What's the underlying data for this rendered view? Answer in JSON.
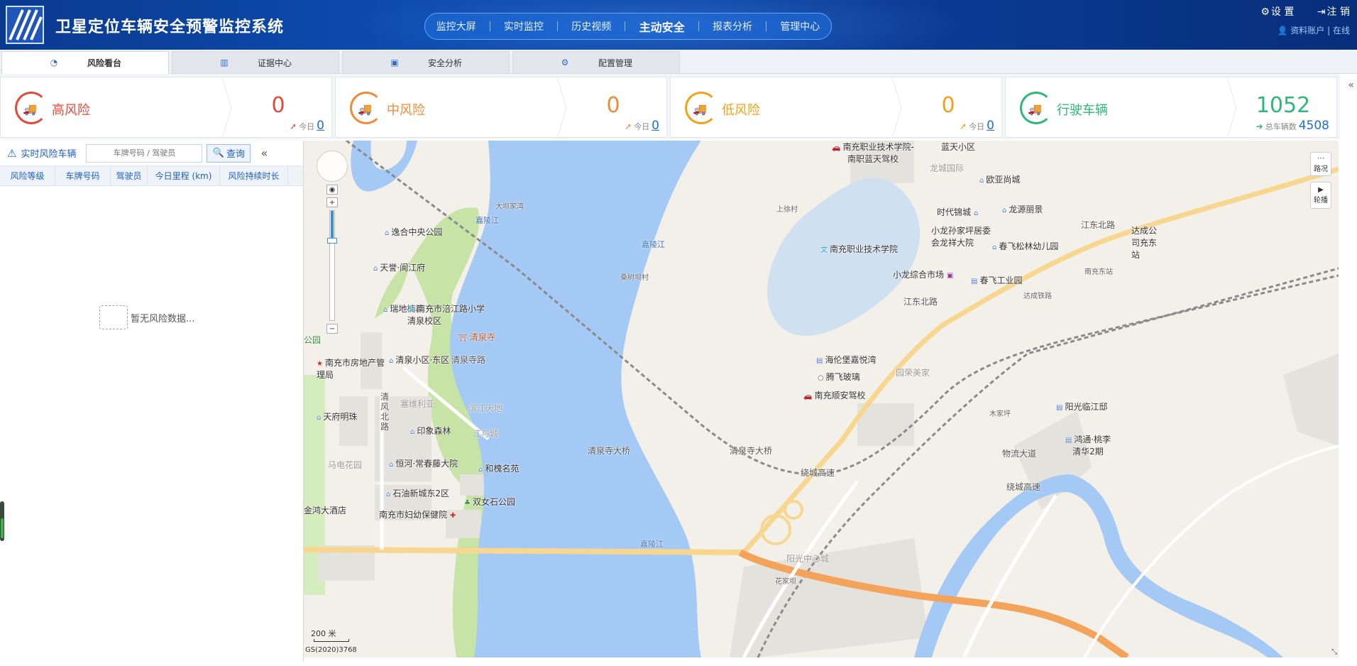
{
  "header": {
    "title": "卫星定位车辆安全预警监控系统",
    "nav": [
      "监控大屏",
      "实时监控",
      "历史视频",
      "主动安全",
      "报表分析",
      "管理中心"
    ],
    "active_nav": "主动安全",
    "settings_label": "设 置",
    "logout_label": "注 销",
    "account_label": "资料账户",
    "status_label": "在线"
  },
  "subtabs": {
    "items": [
      {
        "label": "风险看台",
        "icon": "clock-icon"
      },
      {
        "label": "证据中心",
        "icon": "bar-chart-icon"
      },
      {
        "label": "安全分析",
        "icon": "image-icon"
      },
      {
        "label": "配置管理",
        "icon": "gears-icon"
      }
    ]
  },
  "cards": [
    {
      "name": "高风险",
      "value": "0",
      "sub_label": "今日",
      "sub_value": "0",
      "color": "#e24a3b"
    },
    {
      "name": "中风险",
      "value": "0",
      "sub_label": "今日",
      "sub_value": "0",
      "color": "#f08b3a"
    },
    {
      "name": "低风险",
      "value": "0",
      "sub_label": "今日",
      "sub_value": "0",
      "color": "#f0a21a"
    },
    {
      "name": "行驶车辆",
      "value": "1052",
      "sub_label": "总车辆数",
      "sub_value": "4508",
      "color": "#2fb679"
    }
  ],
  "left_panel": {
    "title": "实时风险车辆",
    "search_placeholder": "车牌号码 / 驾驶员",
    "search_button": "查询",
    "columns": [
      "风险等级",
      "车牌号码",
      "驾驶员",
      "今日里程 (km)",
      "风险持续时长"
    ],
    "empty_text": "暂无风险数据..."
  },
  "map": {
    "controls": {
      "traffic_label": "路况",
      "playback_label": "轮播"
    },
    "scale_label": "200 米",
    "copyright": "GS(2020)3768",
    "labels": {
      "p01": "清泉寺大桥",
      "p02": "清泉寺大桥",
      "p03": "绕城高速",
      "p04": "绕城高速",
      "p05": "江东北路",
      "p06": "江东北路",
      "p07": "嘉陵江",
      "p08": "嘉陵江",
      "p09": "嘉陵江",
      "p10": "逸合中央公园",
      "p11": "天誉·阆江府",
      "p12": "瑞地楠郡",
      "p13": "南充市涪江路小学清泉校区",
      "p14": "清泉寺",
      "p15": "南充市房地产管理局",
      "p16": "清泉小区·东区",
      "p17": "天府明珠",
      "p18": "印象森林",
      "p19": "恒河·常春藤大院",
      "p20": "和槐名苑",
      "p21": "石油新城东2区",
      "p22": "双女石公园",
      "p23": "南充市妇幼保健院",
      "p24": "金鸿大酒店",
      "p25": "马电花园",
      "p26": "塞维利亚",
      "p27": "滨江天地",
      "p28": "江与城",
      "p29": "清风北路",
      "p30": "清泉寺路",
      "p31": "大坝家湾",
      "p32": "桑树坝村",
      "p33": "南充职业技术学院",
      "p34": "南充职业技术学院-南职蓝天驾校",
      "p35": "蓝天小区",
      "p36": "龙城国际",
      "p37": "欧亚尚城",
      "p38": "时代锦城",
      "p39": "龙源丽景",
      "p40": "小龙孙家坪居委会龙祥大院",
      "p41": "春飞松林幼儿园",
      "p42": "小龙综合市场",
      "p43": "春飞工业园",
      "p44": "海伦堡嘉悦湾",
      "p45": "腾飞玻璃",
      "p46": "南充顺安驾校",
      "p47": "园荣美家",
      "p48": "阳光临江邸",
      "p49": "鸿通·桃李清华2期",
      "p50": "南充东站",
      "p51": "达成公司充东站",
      "p52": "上徐村",
      "p53": "木家坪",
      "p54": "阳光中心城",
      "p55": "花家坝",
      "p56": "物流大道",
      "p57": "达成铁路",
      "p58": "公园"
    }
  },
  "colors": {
    "water": "#a4c9f5",
    "green": "#c7e3a6",
    "road_orange": "#f4a35a",
    "road_yellow": "#f7d790",
    "campus": "#cfe0f0",
    "block_gray": "#e4e2dd"
  }
}
